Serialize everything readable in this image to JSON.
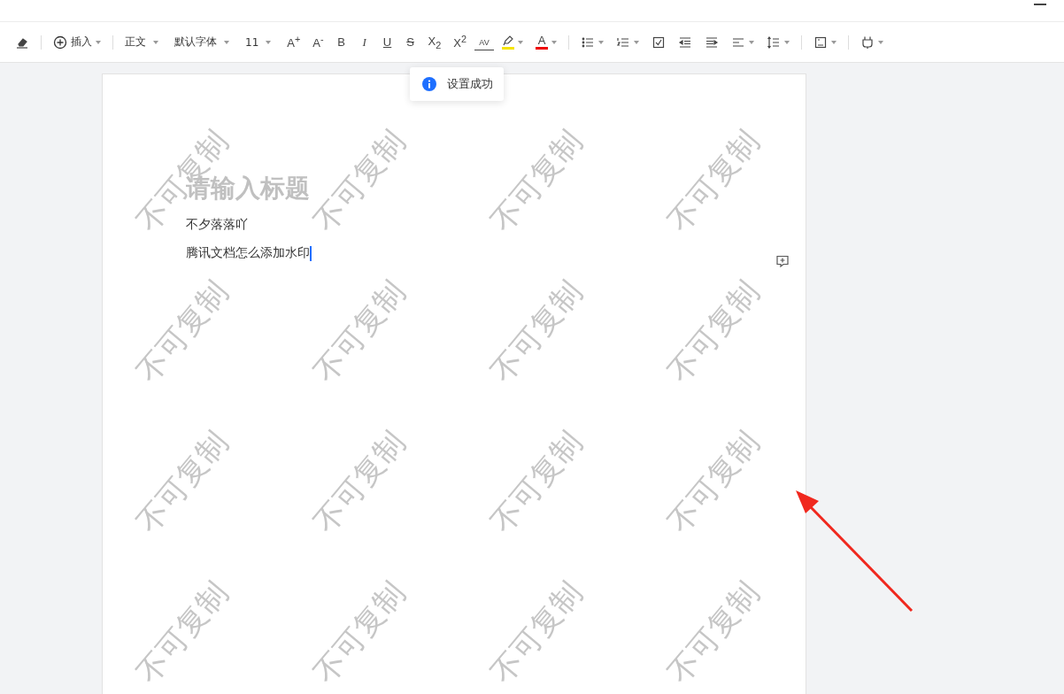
{
  "toolbar": [
    {
      "kind": "eraser",
      "dropdown": false
    },
    {
      "kind": "divider"
    },
    {
      "kind": "insert",
      "label": "插入",
      "dropdown": true
    },
    {
      "kind": "divider"
    },
    {
      "kind": "select",
      "label": "正文",
      "dropdown": true
    },
    {
      "kind": "select",
      "label": "默认字体",
      "dropdown": true
    },
    {
      "kind": "select",
      "label": "11",
      "dropdown": true
    },
    {
      "kind": "glyph",
      "glyph": "A$^{+}$",
      "dropdown": false
    },
    {
      "kind": "glyph",
      "glyph": "A$^{-}$",
      "dropdown": false
    },
    {
      "kind": "glyph",
      "glyph": "B",
      "dropdown": false
    },
    {
      "kind": "italic",
      "glyph": "I",
      "dropdown": false
    },
    {
      "kind": "underline",
      "glyph": "U",
      "dropdown": false
    },
    {
      "kind": "strike",
      "glyph": "S",
      "dropdown": false
    },
    {
      "kind": "glyph",
      "glyph": "X$_{2}$",
      "dropdown": false
    },
    {
      "kind": "glyph",
      "glyph": "X$^{2}$",
      "dropdown": false
    },
    {
      "kind": "spacing",
      "glyph": "AV",
      "dropdown": false
    },
    {
      "kind": "highlight",
      "color": "#f5e400",
      "dropdown": true
    },
    {
      "kind": "fontcolor",
      "glyph": "A",
      "color": "#ee0000",
      "dropdown": true
    },
    {
      "kind": "divider"
    },
    {
      "kind": "bullets",
      "dropdown": true
    },
    {
      "kind": "numbers",
      "dropdown": true
    },
    {
      "kind": "checklist"
    },
    {
      "kind": "outdent",
      "dropdown": false
    },
    {
      "kind": "indent",
      "dropdown": false
    },
    {
      "kind": "align",
      "dropdown": true
    },
    {
      "kind": "linespacing",
      "dropdown": true
    },
    {
      "kind": "divider"
    },
    {
      "kind": "frame",
      "dropdown": true
    },
    {
      "kind": "divider"
    },
    {
      "kind": "plug",
      "dropdown": true
    }
  ],
  "toast": {
    "text": "设置成功"
  },
  "document": {
    "title": {
      "placeholder": "请输入标题"
    },
    "paragraphs": [
      {
        "text": "不夕落落吖",
        "cursor": false
      },
      {
        "text": "腾讯文档怎么添加水印",
        "cursor": true
      }
    ],
    "watermark_tiles": [
      "不可复制",
      "不可复制",
      "不可复制",
      "不可复制",
      "不可复制",
      "不可复制",
      "不可复制",
      "不可复制",
      "不可复制",
      "不可复制",
      "不可复制",
      "不可复制",
      "不可复制",
      "不可复制",
      "不可复制",
      "不可复制"
    ]
  }
}
